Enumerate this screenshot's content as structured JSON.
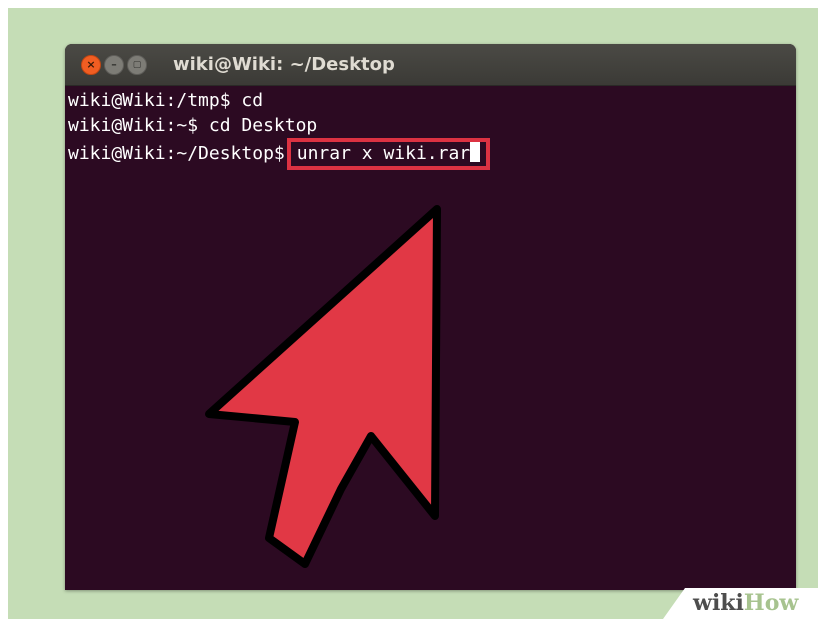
{
  "window": {
    "title": "wiki@Wiki: ~/Desktop",
    "buttons": {
      "close": "×",
      "minimize": "–",
      "maximize": "▢"
    }
  },
  "terminal": {
    "lines": [
      {
        "prompt": "wiki@Wiki:/tmp$",
        "command": " cd"
      },
      {
        "prompt": "wiki@Wiki:~$",
        "command": " cd Desktop"
      },
      {
        "prompt": "wiki@Wiki:~/Desktop$",
        "command": "unrar x wiki.rar"
      }
    ]
  },
  "annotation": {
    "highlight_color": "#dc3242",
    "arrow_color": "#e13845",
    "arrow_outline": "#000000",
    "pointer-icon": "arrow-cursor-icon"
  },
  "watermark": {
    "part1": "wiki",
    "part2": "How"
  },
  "colors": {
    "terminal_bg": "#2c0a22",
    "titlebar_bg": "#3c3b37",
    "backdrop": "#c5ddb6"
  }
}
